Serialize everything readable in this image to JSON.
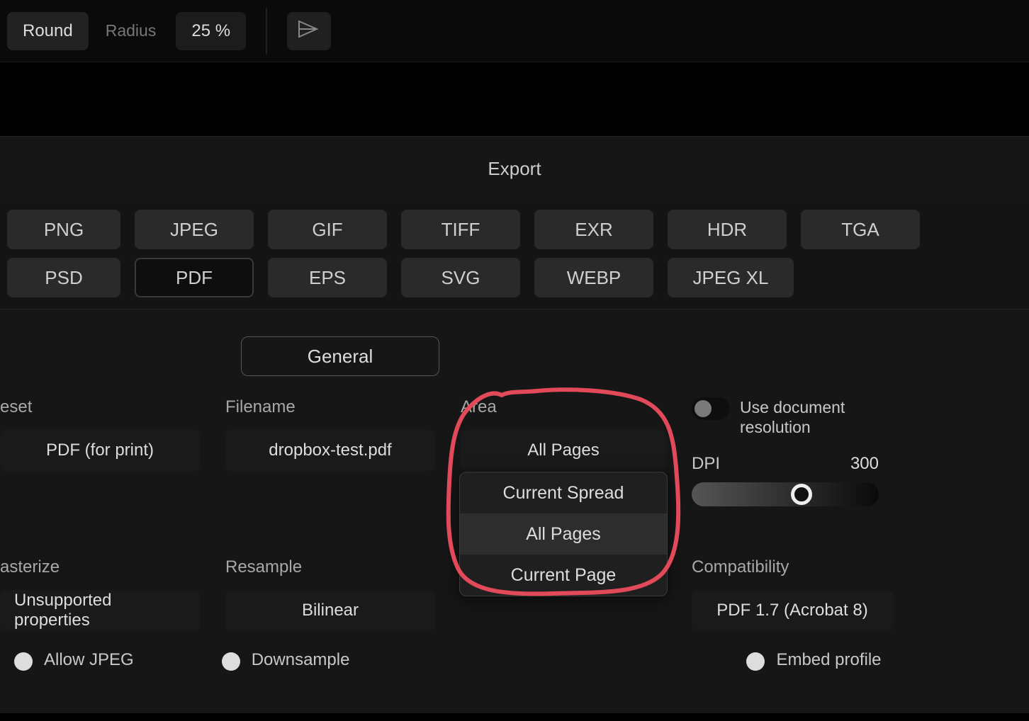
{
  "toolbar": {
    "corner_style": "Round",
    "radius_label": "Radius",
    "radius_value": "25 %"
  },
  "export": {
    "title": "Export",
    "formats_row1": [
      "PNG",
      "JPEG",
      "GIF",
      "TIFF",
      "EXR",
      "HDR",
      "TGA"
    ],
    "formats_row2": [
      "PSD",
      "PDF",
      "EPS",
      "SVG",
      "WEBP",
      "JPEG XL"
    ],
    "selected_format": "PDF",
    "tab_general": "General",
    "preset_label": "eset",
    "preset_value": "PDF (for print)",
    "filename_label": "Filename",
    "filename_value": "dropbox-test.pdf",
    "area_label": "Area",
    "area_value": "All Pages",
    "area_options": [
      "Current Spread",
      "All Pages",
      "Current Page"
    ],
    "use_doc_res_label": "Use document resolution",
    "dpi_label": "DPI",
    "dpi_value": "300",
    "rasterize_label": "asterize",
    "rasterize_value": "Unsupported properties",
    "resample_label": "Resample",
    "resample_value": "Bilinear",
    "compat_label": "Compatibility",
    "compat_value": "PDF 1.7 (Acrobat 8)",
    "allow_jpeg_label": "Allow JPEG",
    "downsample_label": "Downsample",
    "embed_profile_label": "Embed profile"
  }
}
